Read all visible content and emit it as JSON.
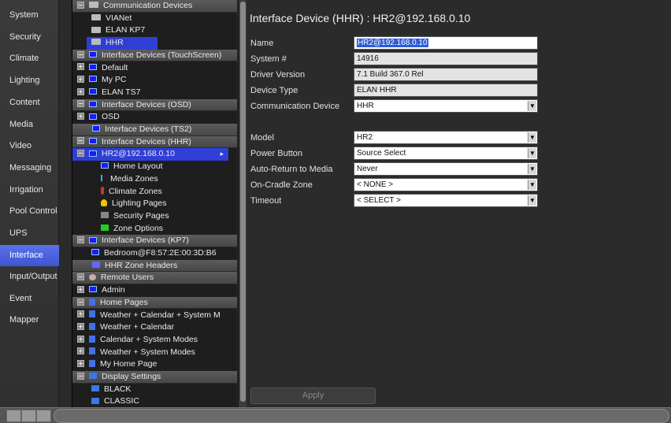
{
  "nav": {
    "items": [
      "System",
      "Security",
      "Climate",
      "Lighting",
      "Content",
      "Media",
      "Video",
      "Messaging",
      "Irrigation",
      "Pool Control",
      "UPS",
      "Interface",
      "Input/Output",
      "Event Mapper"
    ],
    "active": "Interface"
  },
  "tree": {
    "rows": [
      {
        "label": "Communication Devices",
        "type": "hdr",
        "toggle": "minus",
        "icon": "device"
      },
      {
        "label": "VIANet",
        "indent": 2,
        "icon": "device"
      },
      {
        "label": "ELAN KP7",
        "indent": 2,
        "icon": "device"
      },
      {
        "label": "HHR",
        "indent": 2,
        "icon": "device",
        "selected": true
      },
      {
        "label": "Interface Devices (TouchScreen)",
        "type": "hdr",
        "toggle": "minus",
        "icon": "screen"
      },
      {
        "label": "Default",
        "indent": 1,
        "toggle": "plus",
        "icon": "screen"
      },
      {
        "label": "My PC",
        "indent": 1,
        "toggle": "plus",
        "icon": "screen"
      },
      {
        "label": "ELAN TS7",
        "indent": 1,
        "toggle": "plus",
        "icon": "screen"
      },
      {
        "label": "Interface Devices (OSD)",
        "type": "hdr",
        "toggle": "minus",
        "icon": "screen"
      },
      {
        "label": "OSD",
        "indent": 1,
        "toggle": "plus",
        "icon": "screen"
      },
      {
        "label": "Interface Devices (TS2)",
        "type": "hdr",
        "icon": "screen",
        "noToggle": true
      },
      {
        "label": "Interface Devices (HHR)",
        "type": "hdr",
        "toggle": "minus",
        "icon": "screen"
      },
      {
        "label": "HR2@192.168.0.10",
        "indent": 1,
        "toggle": "minus",
        "icon": "screen",
        "selected": true,
        "arrow": "▸"
      },
      {
        "label": "Home Layout",
        "indent": 3,
        "icon": "screen"
      },
      {
        "label": "Media Zones",
        "indent": 3,
        "icon": "music"
      },
      {
        "label": "Climate Zones",
        "indent": 3,
        "icon": "thermo"
      },
      {
        "label": "Lighting Pages",
        "indent": 3,
        "icon": "bulb"
      },
      {
        "label": "Security Pages",
        "indent": 3,
        "icon": "sec"
      },
      {
        "label": "Zone Options",
        "indent": 3,
        "icon": "zone"
      },
      {
        "label": "Interface Devices (KP7)",
        "type": "hdr",
        "toggle": "minus",
        "icon": "screen"
      },
      {
        "label": "Bedroom@F8:57:2E:00:3D:B6",
        "indent": 2,
        "icon": "screen"
      },
      {
        "label": "HHR Zone Headers",
        "type": "hdr",
        "icon": "hdrs",
        "noToggle": true
      },
      {
        "label": "Remote Users",
        "type": "hdr",
        "toggle": "minus",
        "icon": "users"
      },
      {
        "label": "Admin",
        "indent": 1,
        "toggle": "plus",
        "icon": "screen"
      },
      {
        "label": "Home Pages",
        "type": "hdr",
        "toggle": "minus",
        "icon": "page"
      },
      {
        "label": "Weather + Calendar + System M",
        "indent": 1,
        "toggle": "plus",
        "icon": "page"
      },
      {
        "label": "Weather + Calendar",
        "indent": 1,
        "toggle": "plus",
        "icon": "page"
      },
      {
        "label": "Calendar + System Modes",
        "indent": 1,
        "toggle": "plus",
        "icon": "page"
      },
      {
        "label": "Weather + System Modes",
        "indent": 1,
        "toggle": "plus",
        "icon": "page"
      },
      {
        "label": "My Home Page",
        "indent": 1,
        "toggle": "plus",
        "icon": "page"
      },
      {
        "label": "Display Settings",
        "type": "hdr",
        "toggle": "minus",
        "icon": "disp"
      },
      {
        "label": "BLACK",
        "indent": 2,
        "icon": "disp"
      },
      {
        "label": "CLASSIC",
        "indent": 2,
        "icon": "disp"
      }
    ]
  },
  "main": {
    "title": "Interface Device (HHR) : HR2@192.168.0.10",
    "fields": [
      {
        "label": "Name",
        "value": "HR2@192.168.0.10",
        "kind": "text",
        "highlight": true
      },
      {
        "label": "System #",
        "value": "14916",
        "kind": "ro"
      },
      {
        "label": "Driver Version",
        "value": "7.1 Build 367.0 Rel",
        "kind": "ro"
      },
      {
        "label": "Device Type",
        "value": "ELAN HHR",
        "kind": "ro"
      },
      {
        "label": "Communication Device",
        "value": "HHR",
        "kind": "select"
      },
      {
        "label": "Model",
        "value": "HR2",
        "kind": "select"
      },
      {
        "label": "Power Button",
        "value": "Source Select",
        "kind": "select"
      },
      {
        "label": "Auto-Return to Media",
        "value": "Never",
        "kind": "select"
      },
      {
        "label": "On-Cradle Zone",
        "value": "< NONE >",
        "kind": "select"
      },
      {
        "label": "Timeout",
        "value": "< SELECT >",
        "kind": "select"
      }
    ],
    "apply_label": "Apply"
  }
}
